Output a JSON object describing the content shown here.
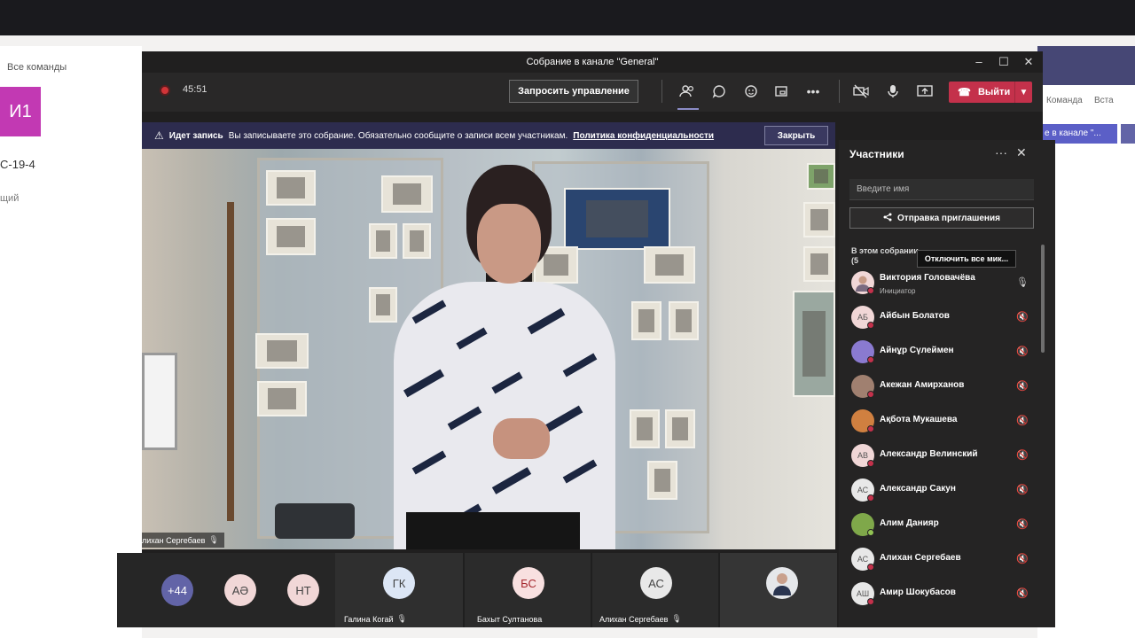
{
  "background": {
    "all_teams": "Все команды",
    "team_tile": "И1",
    "team_name": "С-19-4",
    "general": "щий",
    "right_cmd1": "Команда",
    "right_cmd2": "Вста",
    "channel_tab": "е в канале \"..."
  },
  "meeting": {
    "window_title": "Собрание в канале \"General\"",
    "timer": "45:51",
    "request_control": "Запросить управление",
    "leave": "Выйти",
    "banner": {
      "title": "Идет запись",
      "text": "Вы записываете это собрание. Обязательно сообщите о записи всем участникам.",
      "link": "Политика конфиденциальности",
      "close": "Закрыть"
    },
    "video_name": "Алихан Сергебаев"
  },
  "strip": [
    {
      "initials": "+44",
      "color": "#6264a7",
      "text_color": "#ffffff"
    },
    {
      "initials": "АӘ",
      "color": "#f1d7d7",
      "text_color": "#444444"
    },
    {
      "initials": "НТ",
      "color": "#f1d7d7",
      "text_color": "#444444"
    },
    {
      "initials": "ГК",
      "color": "#dce6f5",
      "text_color": "#444444",
      "name": "Галина Когай"
    },
    {
      "initials": "БС",
      "color": "#f8e0e0",
      "text_color": "#a4262c",
      "name": "Бахыт Султанова"
    },
    {
      "initials": "АС",
      "color": "#e8e8e8",
      "text_color": "#444444",
      "name": "Алихан Сергебаев"
    }
  ],
  "panel": {
    "title": "Участники",
    "search_placeholder": "Введите имя",
    "invite": "Отправка приглашения",
    "section_label": "В этом собрании (5",
    "mute_all": "Отключить все мик...",
    "participants": [
      {
        "initials": "",
        "name": "Виктория Головачёва",
        "role": "Инициатор",
        "avatar_color": "#f0e0d8"
      },
      {
        "initials": "АБ",
        "name": "Айбын Болатов",
        "avatar_color": "#f1d7d7"
      },
      {
        "initials": "",
        "name": "Айнұр Сүлеймен",
        "avatar_color": "#8a7ad0"
      },
      {
        "initials": "",
        "name": "Акежан Амирханов",
        "avatar_color": "#a08070"
      },
      {
        "initials": "",
        "name": "Ақбота Мукашева",
        "avatar_color": "#d08040"
      },
      {
        "initials": "АВ",
        "name": "Александр Велинский",
        "avatar_color": "#f1d7d7"
      },
      {
        "initials": "АС",
        "name": "Александр Сакун",
        "avatar_color": "#e8e8e8"
      },
      {
        "initials": "",
        "name": "Алим Данияр",
        "avatar_color": "#7fa84a"
      },
      {
        "initials": "АС",
        "name": "Алихан Сергебаев",
        "avatar_color": "#e8e8e8"
      },
      {
        "initials": "АШ",
        "name": "Амир Шокубасов",
        "avatar_color": "#e8e8e8"
      }
    ]
  }
}
